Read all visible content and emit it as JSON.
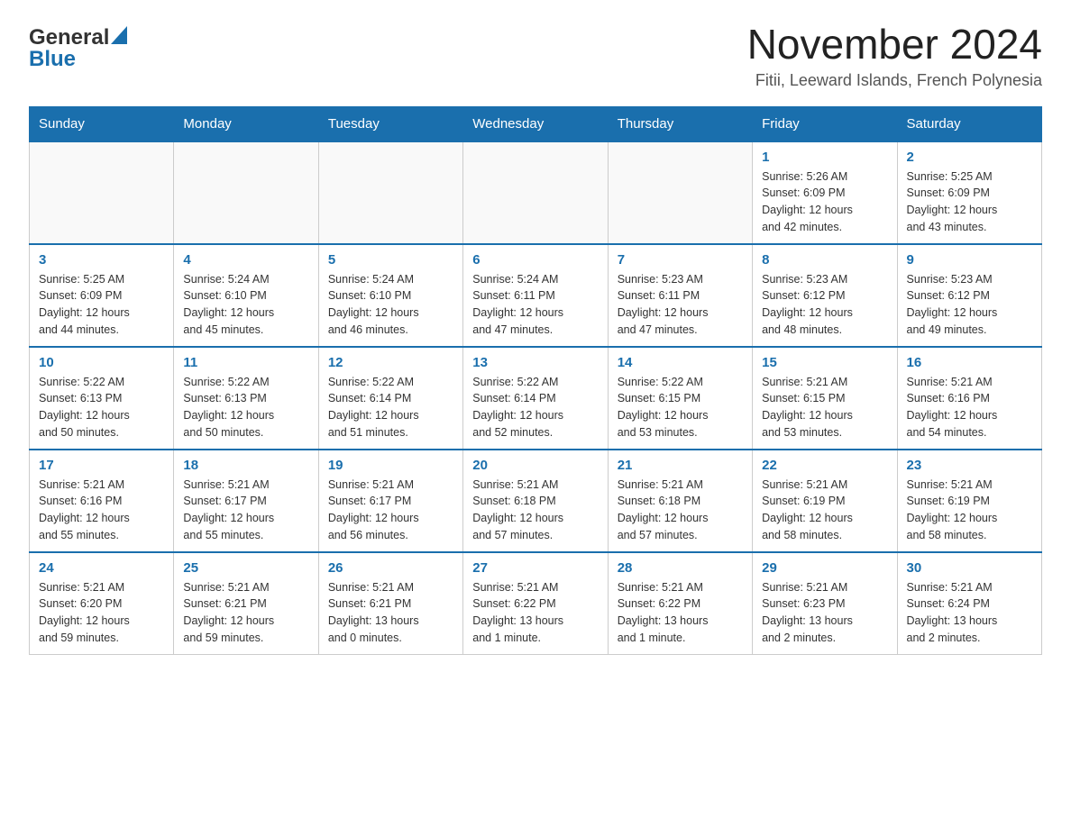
{
  "logo": {
    "general": "General",
    "blue": "Blue"
  },
  "title": "November 2024",
  "subtitle": "Fitii, Leeward Islands, French Polynesia",
  "weekdays": [
    "Sunday",
    "Monday",
    "Tuesday",
    "Wednesday",
    "Thursday",
    "Friday",
    "Saturday"
  ],
  "weeks": [
    [
      {
        "day": "",
        "info": ""
      },
      {
        "day": "",
        "info": ""
      },
      {
        "day": "",
        "info": ""
      },
      {
        "day": "",
        "info": ""
      },
      {
        "day": "",
        "info": ""
      },
      {
        "day": "1",
        "info": "Sunrise: 5:26 AM\nSunset: 6:09 PM\nDaylight: 12 hours\nand 42 minutes."
      },
      {
        "day": "2",
        "info": "Sunrise: 5:25 AM\nSunset: 6:09 PM\nDaylight: 12 hours\nand 43 minutes."
      }
    ],
    [
      {
        "day": "3",
        "info": "Sunrise: 5:25 AM\nSunset: 6:09 PM\nDaylight: 12 hours\nand 44 minutes."
      },
      {
        "day": "4",
        "info": "Sunrise: 5:24 AM\nSunset: 6:10 PM\nDaylight: 12 hours\nand 45 minutes."
      },
      {
        "day": "5",
        "info": "Sunrise: 5:24 AM\nSunset: 6:10 PM\nDaylight: 12 hours\nand 46 minutes."
      },
      {
        "day": "6",
        "info": "Sunrise: 5:24 AM\nSunset: 6:11 PM\nDaylight: 12 hours\nand 47 minutes."
      },
      {
        "day": "7",
        "info": "Sunrise: 5:23 AM\nSunset: 6:11 PM\nDaylight: 12 hours\nand 47 minutes."
      },
      {
        "day": "8",
        "info": "Sunrise: 5:23 AM\nSunset: 6:12 PM\nDaylight: 12 hours\nand 48 minutes."
      },
      {
        "day": "9",
        "info": "Sunrise: 5:23 AM\nSunset: 6:12 PM\nDaylight: 12 hours\nand 49 minutes."
      }
    ],
    [
      {
        "day": "10",
        "info": "Sunrise: 5:22 AM\nSunset: 6:13 PM\nDaylight: 12 hours\nand 50 minutes."
      },
      {
        "day": "11",
        "info": "Sunrise: 5:22 AM\nSunset: 6:13 PM\nDaylight: 12 hours\nand 50 minutes."
      },
      {
        "day": "12",
        "info": "Sunrise: 5:22 AM\nSunset: 6:14 PM\nDaylight: 12 hours\nand 51 minutes."
      },
      {
        "day": "13",
        "info": "Sunrise: 5:22 AM\nSunset: 6:14 PM\nDaylight: 12 hours\nand 52 minutes."
      },
      {
        "day": "14",
        "info": "Sunrise: 5:22 AM\nSunset: 6:15 PM\nDaylight: 12 hours\nand 53 minutes."
      },
      {
        "day": "15",
        "info": "Sunrise: 5:21 AM\nSunset: 6:15 PM\nDaylight: 12 hours\nand 53 minutes."
      },
      {
        "day": "16",
        "info": "Sunrise: 5:21 AM\nSunset: 6:16 PM\nDaylight: 12 hours\nand 54 minutes."
      }
    ],
    [
      {
        "day": "17",
        "info": "Sunrise: 5:21 AM\nSunset: 6:16 PM\nDaylight: 12 hours\nand 55 minutes."
      },
      {
        "day": "18",
        "info": "Sunrise: 5:21 AM\nSunset: 6:17 PM\nDaylight: 12 hours\nand 55 minutes."
      },
      {
        "day": "19",
        "info": "Sunrise: 5:21 AM\nSunset: 6:17 PM\nDaylight: 12 hours\nand 56 minutes."
      },
      {
        "day": "20",
        "info": "Sunrise: 5:21 AM\nSunset: 6:18 PM\nDaylight: 12 hours\nand 57 minutes."
      },
      {
        "day": "21",
        "info": "Sunrise: 5:21 AM\nSunset: 6:18 PM\nDaylight: 12 hours\nand 57 minutes."
      },
      {
        "day": "22",
        "info": "Sunrise: 5:21 AM\nSunset: 6:19 PM\nDaylight: 12 hours\nand 58 minutes."
      },
      {
        "day": "23",
        "info": "Sunrise: 5:21 AM\nSunset: 6:19 PM\nDaylight: 12 hours\nand 58 minutes."
      }
    ],
    [
      {
        "day": "24",
        "info": "Sunrise: 5:21 AM\nSunset: 6:20 PM\nDaylight: 12 hours\nand 59 minutes."
      },
      {
        "day": "25",
        "info": "Sunrise: 5:21 AM\nSunset: 6:21 PM\nDaylight: 12 hours\nand 59 minutes."
      },
      {
        "day": "26",
        "info": "Sunrise: 5:21 AM\nSunset: 6:21 PM\nDaylight: 13 hours\nand 0 minutes."
      },
      {
        "day": "27",
        "info": "Sunrise: 5:21 AM\nSunset: 6:22 PM\nDaylight: 13 hours\nand 1 minute."
      },
      {
        "day": "28",
        "info": "Sunrise: 5:21 AM\nSunset: 6:22 PM\nDaylight: 13 hours\nand 1 minute."
      },
      {
        "day": "29",
        "info": "Sunrise: 5:21 AM\nSunset: 6:23 PM\nDaylight: 13 hours\nand 2 minutes."
      },
      {
        "day": "30",
        "info": "Sunrise: 5:21 AM\nSunset: 6:24 PM\nDaylight: 13 hours\nand 2 minutes."
      }
    ]
  ]
}
